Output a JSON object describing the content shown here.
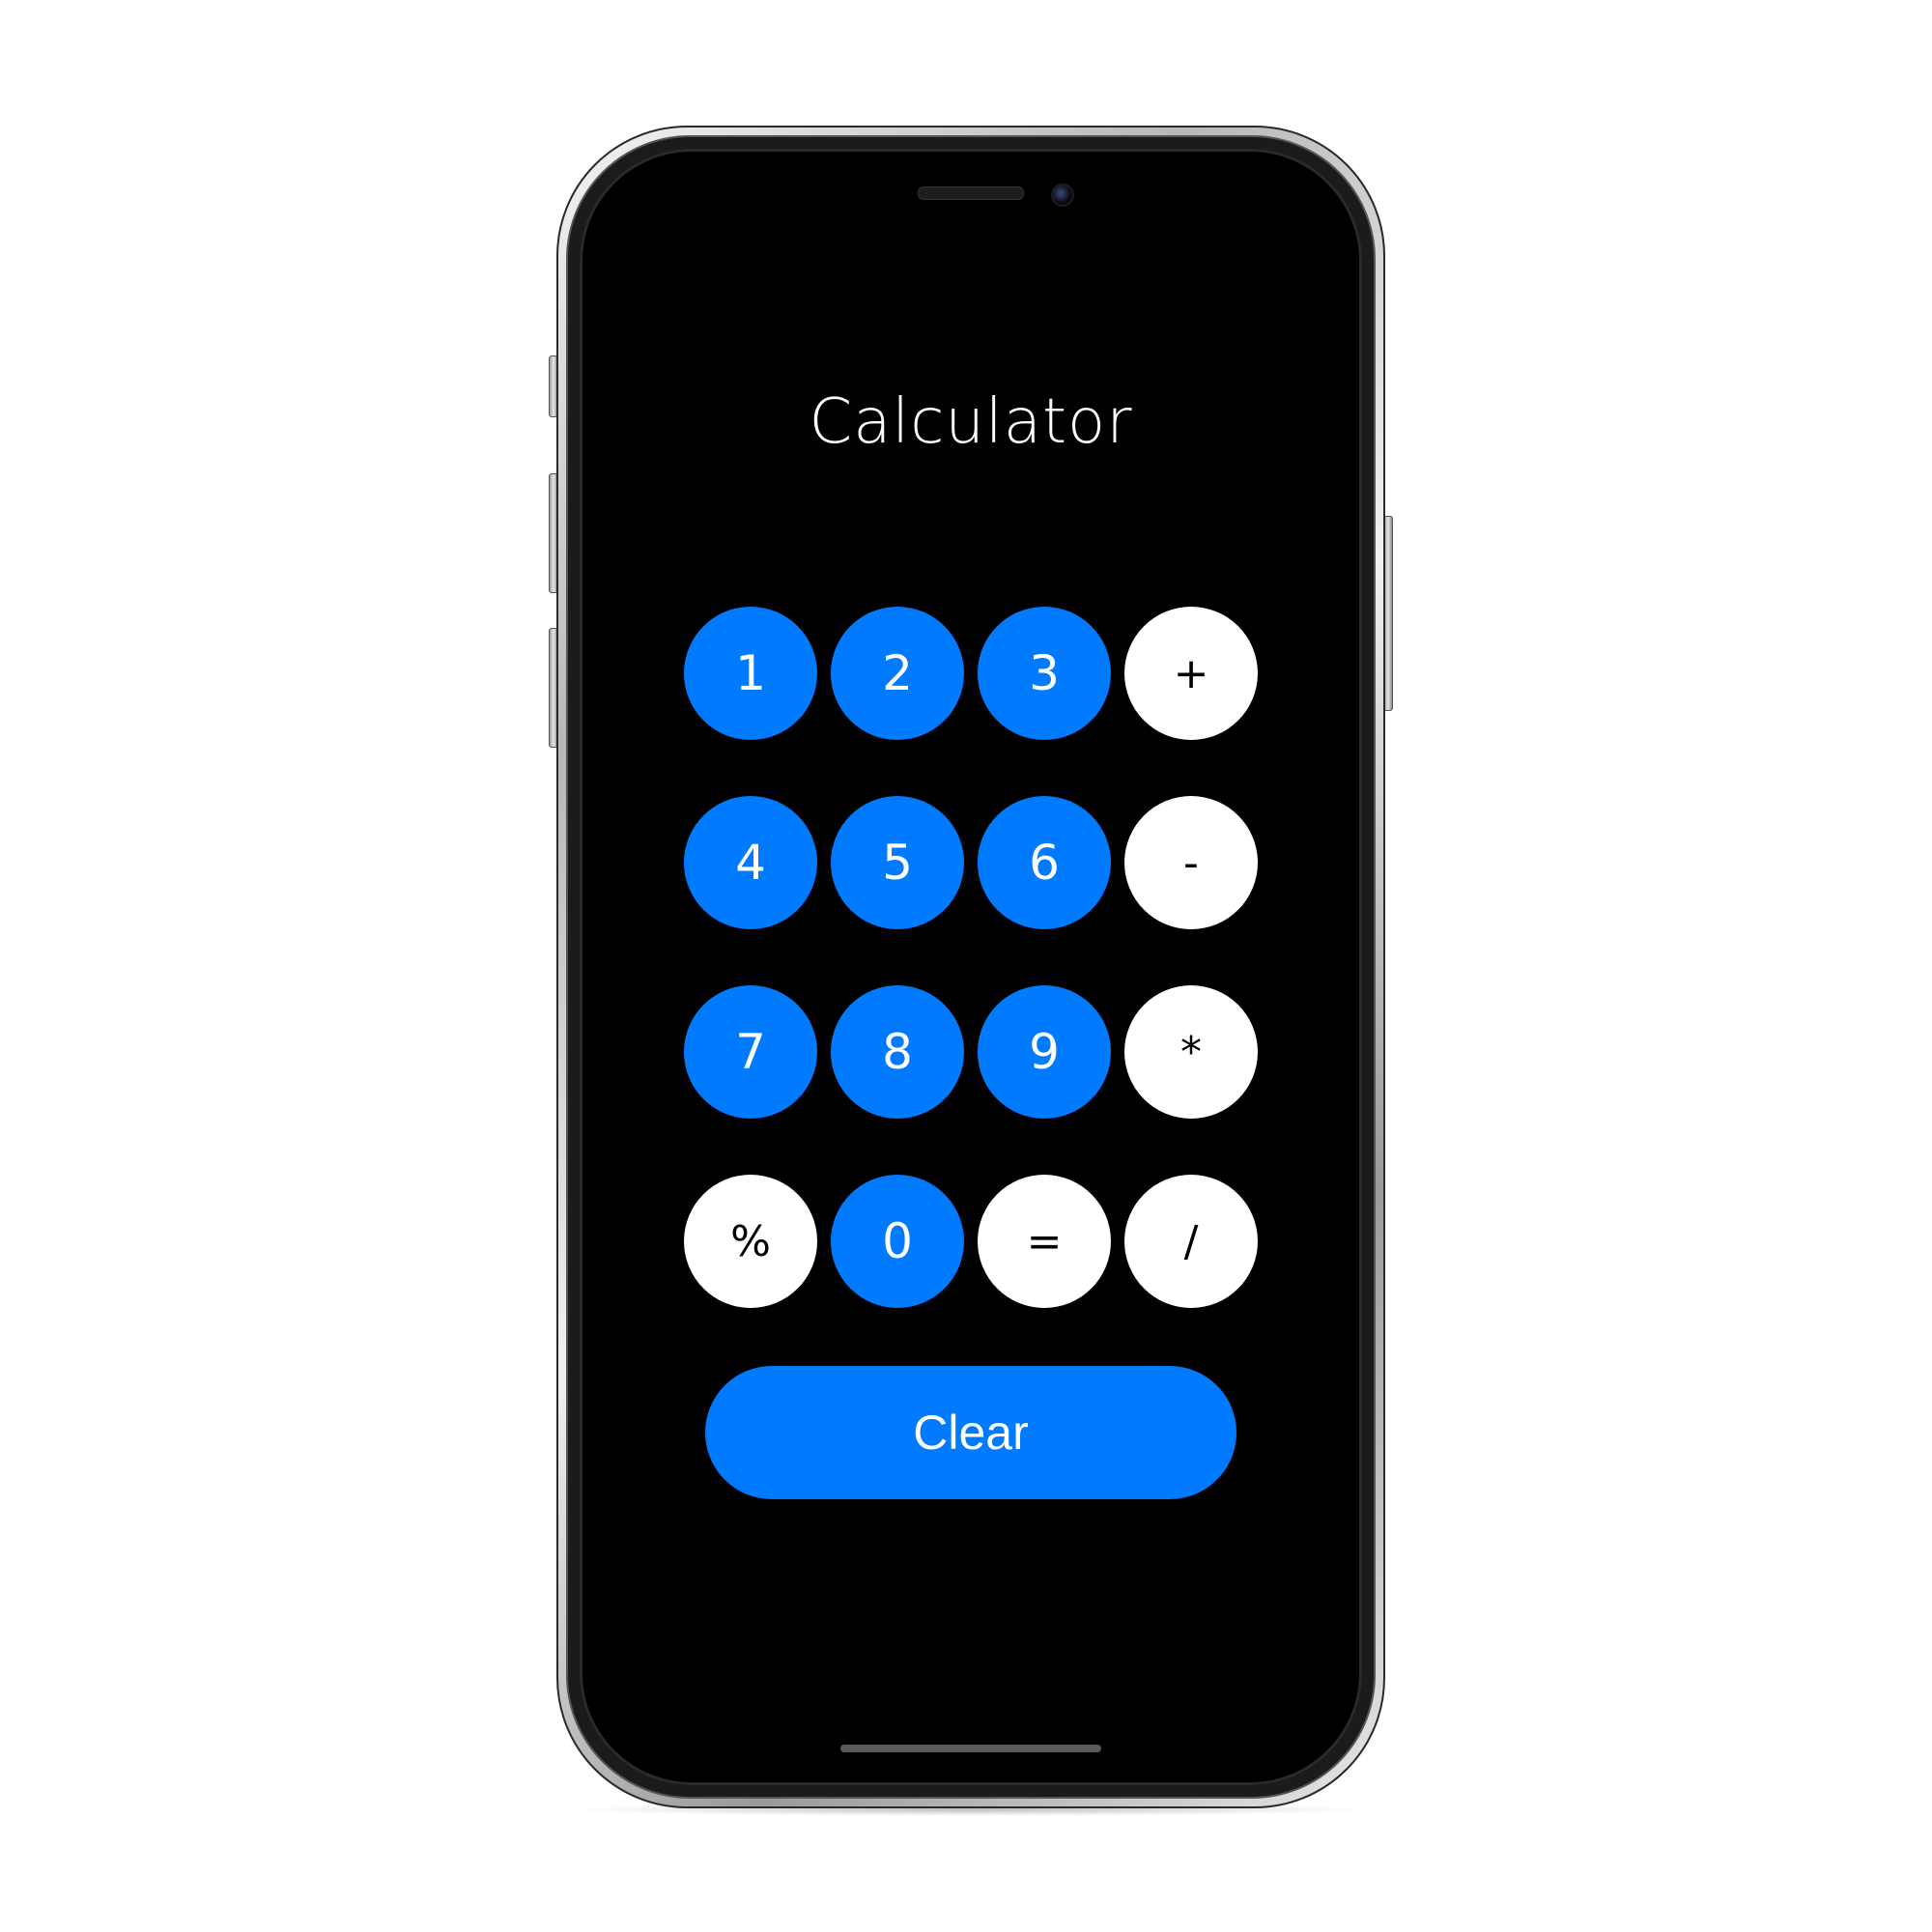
{
  "app": {
    "title": "Calculator"
  },
  "keypad": {
    "keys": [
      {
        "label": "1",
        "style": "blue"
      },
      {
        "label": "2",
        "style": "blue"
      },
      {
        "label": "3",
        "style": "blue"
      },
      {
        "label": "+",
        "style": "white"
      },
      {
        "label": "4",
        "style": "blue"
      },
      {
        "label": "5",
        "style": "blue"
      },
      {
        "label": "6",
        "style": "blue"
      },
      {
        "label": "-",
        "style": "white"
      },
      {
        "label": "7",
        "style": "blue"
      },
      {
        "label": "8",
        "style": "blue"
      },
      {
        "label": "9",
        "style": "blue"
      },
      {
        "label": "*",
        "style": "white"
      },
      {
        "label": "%",
        "style": "white"
      },
      {
        "label": "0",
        "style": "blue"
      },
      {
        "label": "=",
        "style": "white"
      },
      {
        "label": "/",
        "style": "white"
      }
    ]
  },
  "clear": {
    "label": "Clear"
  },
  "colors": {
    "accent": "#007aff",
    "screen_background": "#000000",
    "operator_key": "#ffffff"
  },
  "icons": {
    "speaker": "earpiece-speaker-icon",
    "camera": "front-camera-icon",
    "home": "home-indicator-icon"
  }
}
